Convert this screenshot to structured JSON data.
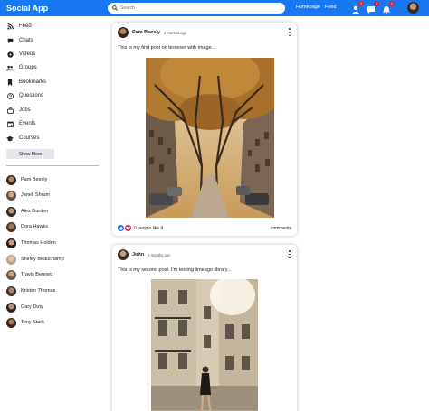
{
  "app": {
    "title": "Social App"
  },
  "search": {
    "placeholder": "Search"
  },
  "nav": {
    "links": [
      "Homepage",
      "Feed"
    ],
    "badges": [
      "1",
      "2",
      "1"
    ]
  },
  "sidebar": {
    "items": [
      {
        "label": "Feed",
        "icon": "rss-icon"
      },
      {
        "label": "Chats",
        "icon": "chat-icon"
      },
      {
        "label": "Videos",
        "icon": "play-circle-icon"
      },
      {
        "label": "Groups",
        "icon": "group-icon"
      },
      {
        "label": "Bookmarks",
        "icon": "bookmark-icon"
      },
      {
        "label": "Questions",
        "icon": "help-circle-icon"
      },
      {
        "label": "Jobs",
        "icon": "work-icon"
      },
      {
        "label": "Events",
        "icon": "event-icon"
      },
      {
        "label": "Courses",
        "icon": "school-icon"
      }
    ],
    "show_more": "Show More",
    "friends": [
      "Pam Beesly",
      "Janell Shrum",
      "Alex Durden",
      "Dora Hawks",
      "Thomas Holden",
      "Shirley Beauchamp",
      "Travis Bennett",
      "Kristen Thomas",
      "Gary Duty",
      "Tony Stark"
    ]
  },
  "posts": [
    {
      "author": "Pam Beesly",
      "date": "5 months ago",
      "text": "This is my first post on browser with image...",
      "likes": "0 people like it",
      "comments": "comments"
    },
    {
      "author": "John",
      "date": "5 months ago",
      "text": "This is my second post. I'm testing timeago library..."
    }
  ],
  "colors": {
    "brand": "#1877f2",
    "badge": "#e41e3f",
    "like": "#1877f2",
    "love": "#e41e3f"
  }
}
